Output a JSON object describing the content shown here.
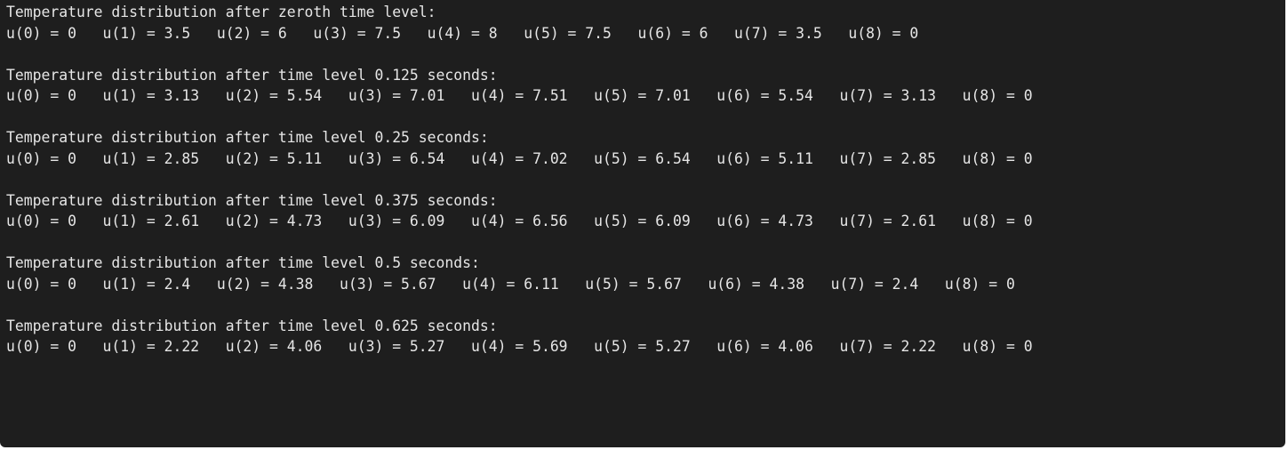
{
  "console": {
    "blocks": [
      {
        "heading": "Temperature distribution after zeroth time level:",
        "values": "u(0) = 0   u(1) = 3.5   u(2) = 6   u(3) = 7.5   u(4) = 8   u(5) = 7.5   u(6) = 6   u(7) = 3.5   u(8) = 0"
      },
      {
        "heading": "Temperature distribution after time level 0.125 seconds:",
        "values": "u(0) = 0   u(1) = 3.13   u(2) = 5.54   u(3) = 7.01   u(4) = 7.51   u(5) = 7.01   u(6) = 5.54   u(7) = 3.13   u(8) = 0"
      },
      {
        "heading": "Temperature distribution after time level 0.25 seconds:",
        "values": "u(0) = 0   u(1) = 2.85   u(2) = 5.11   u(3) = 6.54   u(4) = 7.02   u(5) = 6.54   u(6) = 5.11   u(7) = 2.85   u(8) = 0"
      },
      {
        "heading": "Temperature distribution after time level 0.375 seconds:",
        "values": "u(0) = 0   u(1) = 2.61   u(2) = 4.73   u(3) = 6.09   u(4) = 6.56   u(5) = 6.09   u(6) = 4.73   u(7) = 2.61   u(8) = 0"
      },
      {
        "heading": "Temperature distribution after time level 0.5 seconds:",
        "values": "u(0) = 0   u(1) = 2.4   u(2) = 4.38   u(3) = 5.67   u(4) = 6.11   u(5) = 5.67   u(6) = 4.38   u(7) = 2.4   u(8) = 0"
      },
      {
        "heading": "Temperature distribution after time level 0.625 seconds:",
        "values": "u(0) = 0   u(1) = 2.22   u(2) = 4.06   u(3) = 5.27   u(4) = 5.69   u(5) = 5.27   u(6) = 4.06   u(7) = 2.22   u(8) = 0"
      }
    ]
  },
  "colors": {
    "background": "#1e1e1e",
    "text": "#e6e6e6"
  }
}
